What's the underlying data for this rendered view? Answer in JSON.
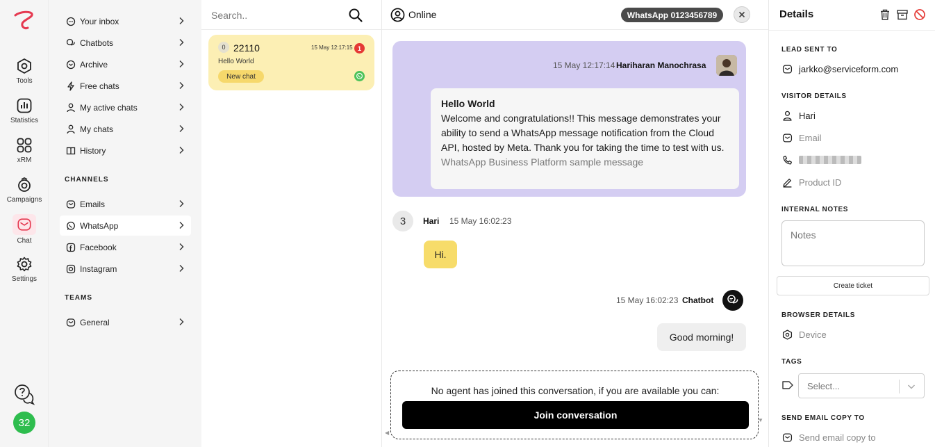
{
  "rail": {
    "items": [
      {
        "label": "Tools",
        "icon": "hexagon-icon"
      },
      {
        "label": "Statistics",
        "icon": "stats-icon"
      },
      {
        "label": "xRM",
        "icon": "grid-icon"
      },
      {
        "label": "Campaigns",
        "icon": "campaign-icon"
      },
      {
        "label": "Chat",
        "icon": "envelope-icon"
      },
      {
        "label": "Settings",
        "icon": "gear-icon"
      }
    ],
    "badge": "32",
    "accent": "#e53950"
  },
  "nav": {
    "items": [
      {
        "label": "Your inbox",
        "icon": "chat-bubble-icon"
      },
      {
        "label": "Chatbots",
        "icon": "chatbot-icon"
      },
      {
        "label": "Archive",
        "icon": "archive-icon"
      },
      {
        "label": "Free chats",
        "icon": "bolt-icon"
      },
      {
        "label": "My active chats",
        "icon": "user-icon"
      },
      {
        "label": "My chats",
        "icon": "user-icon"
      },
      {
        "label": "History",
        "icon": "book-icon"
      }
    ],
    "channels_title": "CHANNELS",
    "channels": [
      {
        "label": "Emails",
        "icon": "envelope-icon"
      },
      {
        "label": "WhatsApp",
        "icon": "whatsapp-icon"
      },
      {
        "label": "Facebook",
        "icon": "facebook-icon"
      },
      {
        "label": "Instagram",
        "icon": "instagram-icon"
      }
    ],
    "teams_title": "TEAMS",
    "teams": [
      {
        "label": "General",
        "icon": "envelope-icon"
      }
    ]
  },
  "list": {
    "search_placeholder": "Search..",
    "cards": [
      {
        "count": "0",
        "name": "22110",
        "time": "15 May 12:17:15",
        "unread": "1",
        "preview": "Hello World",
        "tag": "New chat"
      }
    ]
  },
  "conversation": {
    "status": "Online",
    "channel_pill": "WhatsApp 0123456789",
    "first": {
      "time": "15 May 12:17:14",
      "sender": "Hariharan Manochrasa",
      "title": "Hello World",
      "body": "Welcome and congratulations!! This message demonstrates your ability to send a WhatsApp message notification from the Cloud API, hosted by Meta. Thank you for taking the time to test with us.",
      "footer": "WhatsApp Business Platform sample message"
    },
    "visitor": {
      "num": "3",
      "name": "Hari",
      "time": "15 May 16:02:23",
      "text": "Hi."
    },
    "bot": {
      "time": "15 May 16:02:23",
      "name": "Chatbot",
      "text": "Good morning!"
    },
    "join": {
      "text": "No agent has joined this conversation, if you are available you can:",
      "button": "Join conversation"
    }
  },
  "details": {
    "title": "Details",
    "lead_title": "LEAD SENT TO",
    "lead_email": "jarkko@serviceform.com",
    "visitor_title": "VISITOR DETAILS",
    "visitor_name": "Hari",
    "email_placeholder": "Email",
    "product_placeholder": "Product ID",
    "notes_title": "INTERNAL NOTES",
    "notes_placeholder": "Notes",
    "ticket_button": "Create ticket",
    "browser_title": "BROWSER DETAILS",
    "device": "Device",
    "tags_title": "TAGS",
    "tags_placeholder": "Select...",
    "copy_title": "SEND EMAIL COPY TO",
    "copy_placeholder": "Send email copy to"
  }
}
